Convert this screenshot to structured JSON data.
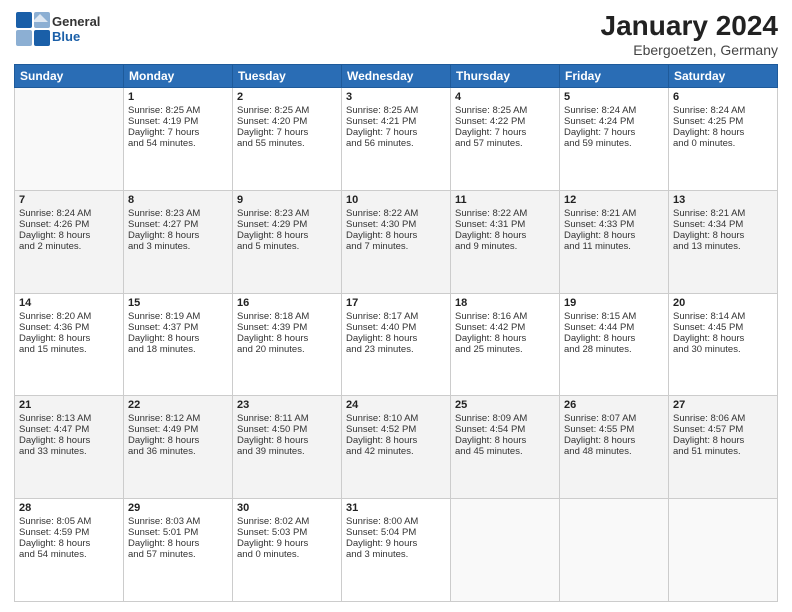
{
  "header": {
    "logo": {
      "general": "General",
      "blue": "Blue"
    },
    "title": "January 2024",
    "subtitle": "Ebergoetzen, Germany"
  },
  "days_of_week": [
    "Sunday",
    "Monday",
    "Tuesday",
    "Wednesday",
    "Thursday",
    "Friday",
    "Saturday"
  ],
  "weeks": [
    [
      {
        "day": "",
        "info": ""
      },
      {
        "day": "1",
        "info": "Sunrise: 8:25 AM\nSunset: 4:19 PM\nDaylight: 7 hours\nand 54 minutes."
      },
      {
        "day": "2",
        "info": "Sunrise: 8:25 AM\nSunset: 4:20 PM\nDaylight: 7 hours\nand 55 minutes."
      },
      {
        "day": "3",
        "info": "Sunrise: 8:25 AM\nSunset: 4:21 PM\nDaylight: 7 hours\nand 56 minutes."
      },
      {
        "day": "4",
        "info": "Sunrise: 8:25 AM\nSunset: 4:22 PM\nDaylight: 7 hours\nand 57 minutes."
      },
      {
        "day": "5",
        "info": "Sunrise: 8:24 AM\nSunset: 4:24 PM\nDaylight: 7 hours\nand 59 minutes."
      },
      {
        "day": "6",
        "info": "Sunrise: 8:24 AM\nSunset: 4:25 PM\nDaylight: 8 hours\nand 0 minutes."
      }
    ],
    [
      {
        "day": "7",
        "info": "Sunrise: 8:24 AM\nSunset: 4:26 PM\nDaylight: 8 hours\nand 2 minutes."
      },
      {
        "day": "8",
        "info": "Sunrise: 8:23 AM\nSunset: 4:27 PM\nDaylight: 8 hours\nand 3 minutes."
      },
      {
        "day": "9",
        "info": "Sunrise: 8:23 AM\nSunset: 4:29 PM\nDaylight: 8 hours\nand 5 minutes."
      },
      {
        "day": "10",
        "info": "Sunrise: 8:22 AM\nSunset: 4:30 PM\nDaylight: 8 hours\nand 7 minutes."
      },
      {
        "day": "11",
        "info": "Sunrise: 8:22 AM\nSunset: 4:31 PM\nDaylight: 8 hours\nand 9 minutes."
      },
      {
        "day": "12",
        "info": "Sunrise: 8:21 AM\nSunset: 4:33 PM\nDaylight: 8 hours\nand 11 minutes."
      },
      {
        "day": "13",
        "info": "Sunrise: 8:21 AM\nSunset: 4:34 PM\nDaylight: 8 hours\nand 13 minutes."
      }
    ],
    [
      {
        "day": "14",
        "info": "Sunrise: 8:20 AM\nSunset: 4:36 PM\nDaylight: 8 hours\nand 15 minutes."
      },
      {
        "day": "15",
        "info": "Sunrise: 8:19 AM\nSunset: 4:37 PM\nDaylight: 8 hours\nand 18 minutes."
      },
      {
        "day": "16",
        "info": "Sunrise: 8:18 AM\nSunset: 4:39 PM\nDaylight: 8 hours\nand 20 minutes."
      },
      {
        "day": "17",
        "info": "Sunrise: 8:17 AM\nSunset: 4:40 PM\nDaylight: 8 hours\nand 23 minutes."
      },
      {
        "day": "18",
        "info": "Sunrise: 8:16 AM\nSunset: 4:42 PM\nDaylight: 8 hours\nand 25 minutes."
      },
      {
        "day": "19",
        "info": "Sunrise: 8:15 AM\nSunset: 4:44 PM\nDaylight: 8 hours\nand 28 minutes."
      },
      {
        "day": "20",
        "info": "Sunrise: 8:14 AM\nSunset: 4:45 PM\nDaylight: 8 hours\nand 30 minutes."
      }
    ],
    [
      {
        "day": "21",
        "info": "Sunrise: 8:13 AM\nSunset: 4:47 PM\nDaylight: 8 hours\nand 33 minutes."
      },
      {
        "day": "22",
        "info": "Sunrise: 8:12 AM\nSunset: 4:49 PM\nDaylight: 8 hours\nand 36 minutes."
      },
      {
        "day": "23",
        "info": "Sunrise: 8:11 AM\nSunset: 4:50 PM\nDaylight: 8 hours\nand 39 minutes."
      },
      {
        "day": "24",
        "info": "Sunrise: 8:10 AM\nSunset: 4:52 PM\nDaylight: 8 hours\nand 42 minutes."
      },
      {
        "day": "25",
        "info": "Sunrise: 8:09 AM\nSunset: 4:54 PM\nDaylight: 8 hours\nand 45 minutes."
      },
      {
        "day": "26",
        "info": "Sunrise: 8:07 AM\nSunset: 4:55 PM\nDaylight: 8 hours\nand 48 minutes."
      },
      {
        "day": "27",
        "info": "Sunrise: 8:06 AM\nSunset: 4:57 PM\nDaylight: 8 hours\nand 51 minutes."
      }
    ],
    [
      {
        "day": "28",
        "info": "Sunrise: 8:05 AM\nSunset: 4:59 PM\nDaylight: 8 hours\nand 54 minutes."
      },
      {
        "day": "29",
        "info": "Sunrise: 8:03 AM\nSunset: 5:01 PM\nDaylight: 8 hours\nand 57 minutes."
      },
      {
        "day": "30",
        "info": "Sunrise: 8:02 AM\nSunset: 5:03 PM\nDaylight: 9 hours\nand 0 minutes."
      },
      {
        "day": "31",
        "info": "Sunrise: 8:00 AM\nSunset: 5:04 PM\nDaylight: 9 hours\nand 3 minutes."
      },
      {
        "day": "",
        "info": ""
      },
      {
        "day": "",
        "info": ""
      },
      {
        "day": "",
        "info": ""
      }
    ]
  ]
}
